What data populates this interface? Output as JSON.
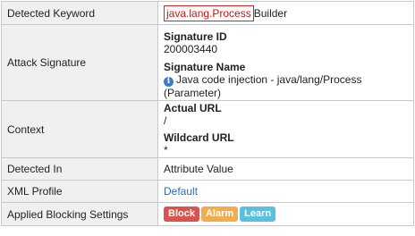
{
  "rows": {
    "keyword": {
      "label": "Detected Keyword",
      "match": "java.lang.Process",
      "rest": "Builder"
    },
    "signature": {
      "label": "Attack Signature",
      "id_title": "Signature ID",
      "id_value": "200003440",
      "name_title": "Signature Name",
      "name_value": "Java code injection - java/lang/Process (Parameter)",
      "info_icon_glyph": "i"
    },
    "context": {
      "label": "Context",
      "actual_title": "Actual URL",
      "actual_value": "/",
      "wildcard_title": "Wildcard URL",
      "wildcard_value": "*"
    },
    "detected_in": {
      "label": "Detected In",
      "value": "Attribute Value"
    },
    "xml_profile": {
      "label": "XML Profile",
      "value": "Default"
    },
    "blocking": {
      "label": "Applied Blocking Settings",
      "block": "Block",
      "alarm": "Alarm",
      "learn": "Learn"
    }
  },
  "colors": {
    "label_bg": "#f0f0f0",
    "border": "#c9c9c9",
    "keyword_highlight": "#e02020",
    "link": "#2a6eb5",
    "block": "#d9534f",
    "alarm": "#f0ad4e",
    "learn": "#5bc0de",
    "info_icon": "#3a7dc4"
  }
}
